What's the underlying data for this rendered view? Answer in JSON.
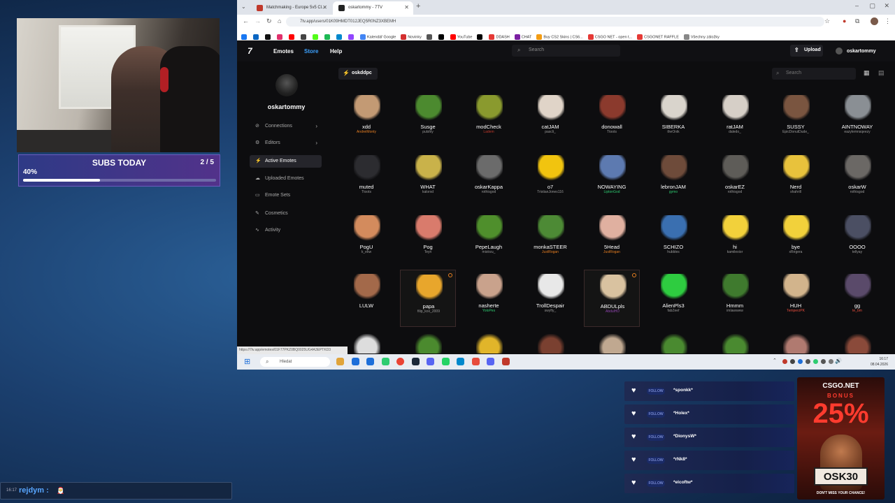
{
  "overlay": {
    "subs": {
      "title": "SUBS TODAY",
      "count": "2 / 5",
      "percent_label": "40%",
      "progress": 0.4
    }
  },
  "browser": {
    "tabs": [
      {
        "label": "Matchmaking - Europe 5v5 Cl...",
        "active": false,
        "favicon_color": "#c0392b"
      },
      {
        "label": "oskartommy - 7TV",
        "active": true,
        "favicon_color": "#222222"
      }
    ],
    "url": "7tv.app/users/01K09HMDT012JEQ5R0NZ3XBEMH",
    "bookmarks": [
      {
        "label": "",
        "color": "#1877f2"
      },
      {
        "label": "",
        "color": "#0a66c2"
      },
      {
        "label": "",
        "color": "#111111"
      },
      {
        "label": "",
        "color": "#e1306c"
      },
      {
        "label": "",
        "color": "#ff0000"
      },
      {
        "label": "",
        "color": "#444444"
      },
      {
        "label": "",
        "color": "#53fc18"
      },
      {
        "label": "",
        "color": "#1db954"
      },
      {
        "label": "",
        "color": "#0088cc"
      },
      {
        "label": "",
        "color": "#9146ff"
      },
      {
        "label": "Kalendář Google",
        "color": "#4285f4"
      },
      {
        "label": "Novinky",
        "color": "#d32f2f"
      },
      {
        "label": "",
        "color": "#555555"
      },
      {
        "label": "",
        "color": "#000000"
      },
      {
        "label": "YouTube",
        "color": "#ff0000"
      },
      {
        "label": "",
        "color": "#000000"
      },
      {
        "label": "DDASH",
        "color": "#e53935"
      },
      {
        "label": "CHAT",
        "color": "#7b1fa2"
      },
      {
        "label": "Buy CS2 Skins | CS6...",
        "color": "#f39c12"
      },
      {
        "label": "CSGO NET - open t...",
        "color": "#e53935"
      },
      {
        "label": "CSGONET RAFFLE",
        "color": "#e53935"
      },
      {
        "label": "Všechny záložky",
        "color": "#888888"
      }
    ],
    "status_url": "https://7tv.app/emotes/01F77PKZ0BQ0025UG4A3EPTKD3"
  },
  "app": {
    "nav": {
      "logo": "7",
      "emotes": "Emotes",
      "store": "Store",
      "help": "Help"
    },
    "search_placeholder": "Search",
    "upload_label": "Upload",
    "profile_name": "oskartommy",
    "sidebar": {
      "username": "oskartommy",
      "items": [
        {
          "label": "Connections",
          "icon": "⊘",
          "chevron": true,
          "active": false
        },
        {
          "label": "Editors",
          "icon": "⚙",
          "chevron": true,
          "active": false
        },
        {
          "label": "Active Emotes",
          "icon": "⚡",
          "chevron": false,
          "active": true
        },
        {
          "label": "Uploaded Emotes",
          "icon": "☁",
          "chevron": false,
          "active": false
        },
        {
          "label": "Emote Sets",
          "icon": "▭",
          "chevron": false,
          "active": false
        },
        {
          "label": "Cosmetics",
          "icon": "✎",
          "chevron": false,
          "active": false
        },
        {
          "label": "Activity",
          "icon": "∿",
          "chevron": false,
          "active": false
        }
      ]
    },
    "emote_set_chip": "oskddpc",
    "content_search_placeholder": "Search",
    "emotes": [
      {
        "name": "xdd",
        "owner": "AndreiMonty",
        "owner_color": "#e67e22",
        "color": "#c39a74"
      },
      {
        "name": "Susge",
        "owner": "pulshly",
        "owner_color": "#999999",
        "color": "#4c8a2f"
      },
      {
        "name": "modCheck",
        "owner": "Ladem",
        "owner_color": "#c0392b",
        "color": "#8a9a2e"
      },
      {
        "name": "catJAM",
        "owner": "pascli_",
        "owner_color": "#999999",
        "color": "#e0d4c8"
      },
      {
        "name": "donowall",
        "owner": "Ttoots",
        "owner_color": "#999999",
        "color": "#8b3a2d"
      },
      {
        "name": "SIBERKA",
        "owner": "theOnik",
        "owner_color": "#999999",
        "color": "#d9d4cc"
      },
      {
        "name": "ratJAM",
        "owner": "daledo_",
        "owner_color": "#999999",
        "color": "#d6cfc7"
      },
      {
        "name": "SUSSY",
        "owner": "EpicDonutDude_",
        "owner_color": "#999999",
        "color": "#7a5540"
      },
      {
        "name": "AINTNOWAY",
        "owner": "eazylemnsqeezy",
        "owner_color": "#999999",
        "color": "#8a8f94"
      },
      {
        "name": "muted",
        "owner": "Ttoots",
        "owner_color": "#999999",
        "color": "#2c2c30"
      },
      {
        "name": "WHAT",
        "owner": "kalorxd",
        "owner_color": "#999999",
        "color": "#c9b24a"
      },
      {
        "name": "oskarKappa",
        "owner": "rothisgod",
        "owner_color": "#999999",
        "color": "#6b6b6b"
      },
      {
        "name": "o7",
        "owner": "TristianJones116",
        "owner_color": "#999999",
        "color": "#f1c40f"
      },
      {
        "name": "NOWAYING",
        "owner": "LiptonGod",
        "owner_color": "#2ecc71",
        "color": "#5d7ab0"
      },
      {
        "name": "lebronJAM",
        "owner": "gymo",
        "owner_color": "#2ecc71",
        "color": "#6e4b3a"
      },
      {
        "name": "oskarEZ",
        "owner": "rothisgod",
        "owner_color": "#999999",
        "color": "#5e5c58"
      },
      {
        "name": "Nerd",
        "owner": "shahrill",
        "owner_color": "#999999",
        "color": "#e8c23c"
      },
      {
        "name": "oskarW",
        "owner": "rothisgod",
        "owner_color": "#999999",
        "color": "#6b6865"
      },
      {
        "name": "PogU",
        "owner": "k_ekw",
        "owner_color": "#999999",
        "color": "#d38b5d"
      },
      {
        "name": "Pog",
        "owner": "Teyn",
        "owner_color": "#999999",
        "color": "#d97b6c"
      },
      {
        "name": "PepeLaugh",
        "owner": "mistrzu_",
        "owner_color": "#999999",
        "color": "#4f8f2c"
      },
      {
        "name": "monkaSTEER",
        "owner": "JustRogan",
        "owner_color": "#e67e22",
        "color": "#4d8a35"
      },
      {
        "name": "5Head",
        "owner": "JustRogan",
        "owner_color": "#e67e22",
        "color": "#e0b0a0"
      },
      {
        "name": "SCHIZO",
        "owner": "hubbles",
        "owner_color": "#999999",
        "color": "#3a6fb0"
      },
      {
        "name": "hi",
        "owner": "kamilexior",
        "owner_color": "#999999",
        "color": "#f2d13b"
      },
      {
        "name": "bye",
        "owner": "xRegera",
        "owner_color": "#999999",
        "color": "#f2d13b"
      },
      {
        "name": "OOOO",
        "owner": "tellyay",
        "owner_color": "#999999",
        "color": "#4b4f63"
      },
      {
        "name": "LULW",
        "owner": "",
        "owner_color": "#999999",
        "color": "#a3694a"
      },
      {
        "name": "papa",
        "owner": "filip_kox_2009",
        "owner_color": "#999999",
        "color": "#e8a62c",
        "selected": true,
        "dot": true
      },
      {
        "name": "nasherte",
        "owner": "YoloPes",
        "owner_color": "#2ecc71",
        "color": "#c9a28c"
      },
      {
        "name": "TrollDespair",
        "owner": "swyfty_",
        "owner_color": "#999999",
        "color": "#e8e8e8"
      },
      {
        "name": "ABDULpls",
        "owner": "AbdulHD",
        "owner_color": "#8e44ad",
        "color": "#d9c2a0",
        "selected": true,
        "dot": true
      },
      {
        "name": "AlienPls3",
        "owner": "fabZeef",
        "owner_color": "#999999",
        "color": "#2ecc40"
      },
      {
        "name": "Hmmm",
        "owner": "imlawwww",
        "owner_color": "#999999",
        "color": "#3f7a2e"
      },
      {
        "name": "HUH",
        "owner": "TemperzPK",
        "owner_color": "#e74c3c",
        "color": "#d2b48c"
      },
      {
        "name": "gg",
        "owner": "te_bm",
        "owner_color": "#e74c3c",
        "color": "#5a4a6a"
      }
    ],
    "partial_row_colors": [
      "#dddddd",
      "#4b8a2e",
      "#e1b52a",
      "#7a4030",
      "#c0a890",
      "#4a8a30",
      "#4a8a30",
      "#b07a70",
      "#8a4a3a"
    ]
  },
  "taskbar": {
    "search_placeholder": "Hledat",
    "time": "16:17",
    "date": "08.04.2026",
    "app_colors": [
      "#e0a43a",
      "#1e6fd9",
      "#1e6fd9",
      "#2ecc71",
      "#ea4335",
      "#1b2838",
      "#5865f2",
      "#25d366",
      "#0088cc",
      "#e74c3c",
      "#5865f2",
      "#c0392b"
    ]
  },
  "alerts": {
    "follow_label": "FOLLOW",
    "follows": [
      "*sponkk*",
      "*Holex*",
      "*DionysW*",
      "*rNk8*",
      "*elcoftw*"
    ]
  },
  "ad": {
    "brand": "CSGO.NET",
    "bonus": "BONUS",
    "percent": "25%",
    "code": "OSK30",
    "tagline": "DON'T MISS YOUR CHANCE!"
  },
  "chat": {
    "time": "16:17",
    "user": "rejdym :",
    "message": "🎅"
  }
}
